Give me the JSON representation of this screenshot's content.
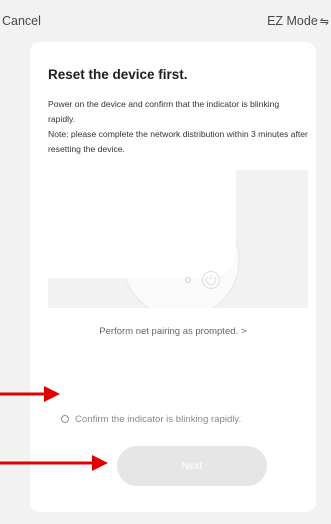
{
  "header": {
    "cancel_label": "Cancel",
    "mode_label": "EZ Mode",
    "mode_icon": "⇋"
  },
  "card": {
    "title": "Reset the device first.",
    "description_lines": [
      "Power on the device and confirm that the indicator is blinking rapidly.",
      "Note: please complete the network distribution within 3 minutes after resetting the device."
    ],
    "help_link": "Perform net pairing as prompted.",
    "help_link_arrow": ">",
    "confirm_label": "Confirm the indicator is blinking rapidly.",
    "confirm_checked": false,
    "next_label": "Next",
    "next_enabled": false
  },
  "colors": {
    "background": "#f2f2f2",
    "card": "#ffffff",
    "button_disabled": "#e6e6e6",
    "annotation_arrow": "#e00000"
  }
}
